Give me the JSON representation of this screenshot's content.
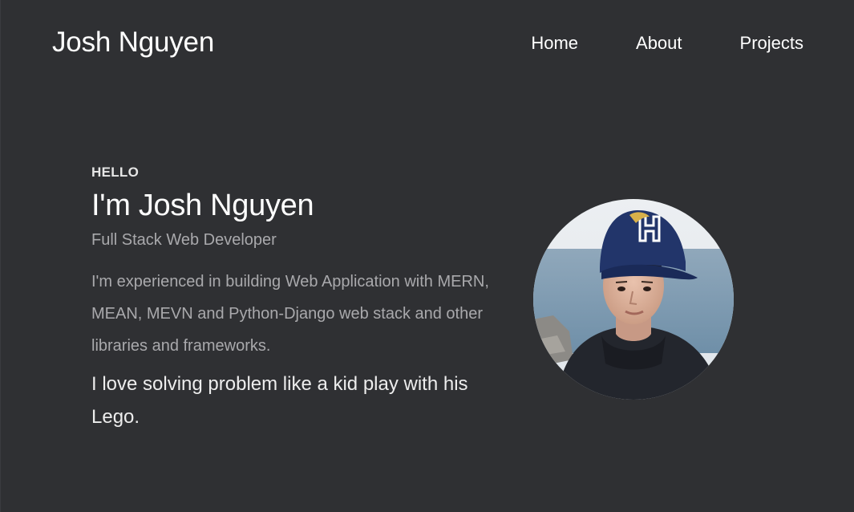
{
  "header": {
    "brand": "Josh Nguyen",
    "nav": [
      "Home",
      "About",
      "Projects"
    ]
  },
  "hero": {
    "greeting": "HELLO",
    "headline": "I'm Josh Nguyen",
    "role": "Full Stack Web Developer",
    "bio": "I'm experienced in building Web Application with MERN, MEAN, MEVN and Python-Django web stack and other libraries and frameworks.",
    "tagline": "I love solving problem like a kid play with his Lego."
  },
  "colors": {
    "background": "#2f3033",
    "text": "#ffffff",
    "muted_text": "#a9a9ac"
  },
  "profile_photo": {
    "icon": "profile-photo"
  }
}
